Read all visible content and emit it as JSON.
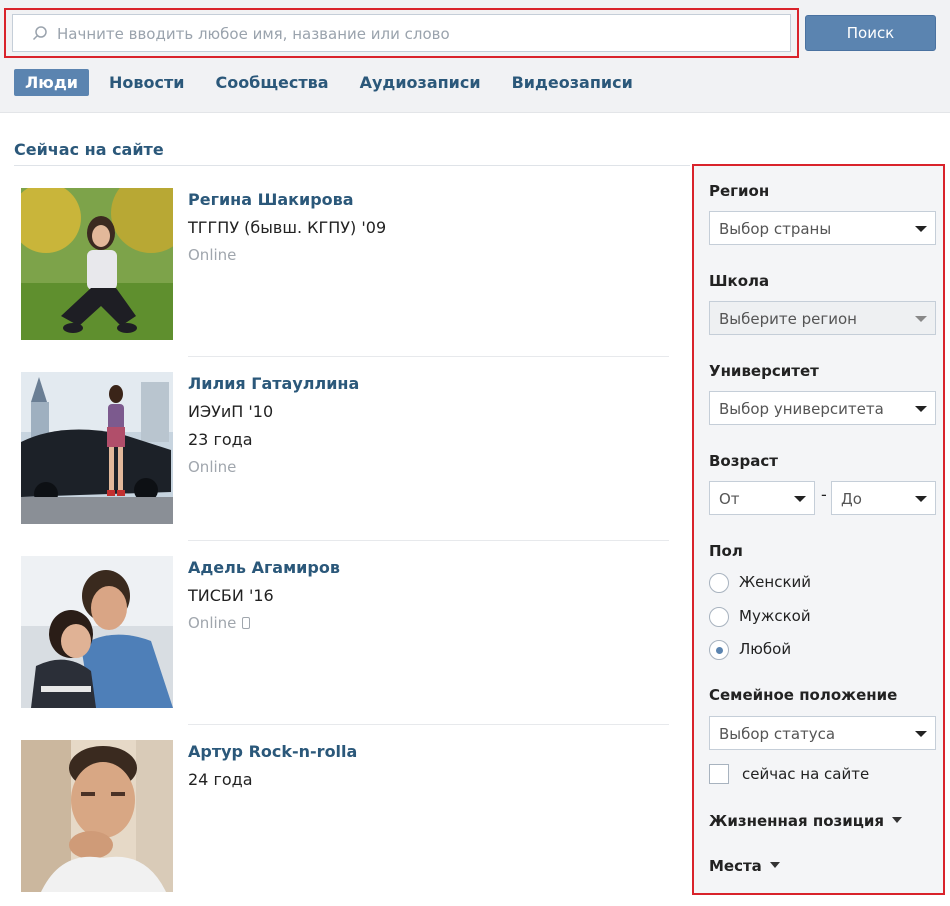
{
  "search": {
    "placeholder": "Начните вводить любое имя, название или слово",
    "button_label": "Поиск"
  },
  "tabs": [
    {
      "label": "Люди",
      "active": true
    },
    {
      "label": "Новости",
      "active": false
    },
    {
      "label": "Сообщества",
      "active": false
    },
    {
      "label": "Аудиозаписи",
      "active": false
    },
    {
      "label": "Видеозаписи",
      "active": false
    }
  ],
  "section_title": "Сейчас на сайте",
  "people": [
    {
      "name": "Регина Шакирова",
      "lines": [
        "ТГГПУ (бывш. КГПУ) '09"
      ],
      "status": "Online",
      "mobile": false
    },
    {
      "name": "Лилия Гатауллина",
      "lines": [
        "ИЭУиП '10",
        "23 года"
      ],
      "status": "Online",
      "mobile": false
    },
    {
      "name": "Адель Агамиров",
      "lines": [
        "ТИСБИ '16"
      ],
      "status": "Online",
      "mobile": true
    },
    {
      "name": "Артур Rock-n-rolla",
      "lines": [
        "24 года"
      ],
      "status": "",
      "mobile": false
    }
  ],
  "filters": {
    "region": {
      "label": "Регион",
      "value": "Выбор страны"
    },
    "school": {
      "label": "Школа",
      "value": "Выберите регион"
    },
    "university": {
      "label": "Университет",
      "value": "Выбор университета"
    },
    "age": {
      "label": "Возраст",
      "from": "От",
      "dash": "-",
      "to": "До"
    },
    "gender": {
      "label": "Пол",
      "options": [
        {
          "label": "Женский",
          "checked": false
        },
        {
          "label": "Мужской",
          "checked": false
        },
        {
          "label": "Любой",
          "checked": true
        }
      ]
    },
    "marital": {
      "label": "Семейное положение",
      "value": "Выбор статуса"
    },
    "online_now": {
      "label": "сейчас на сайте",
      "checked": false
    },
    "life_position": "Жизненная позиция",
    "places": "Места"
  },
  "colors": {
    "accent": "#5b84b0",
    "link": "#2b587a",
    "highlight": "#d9232b"
  }
}
